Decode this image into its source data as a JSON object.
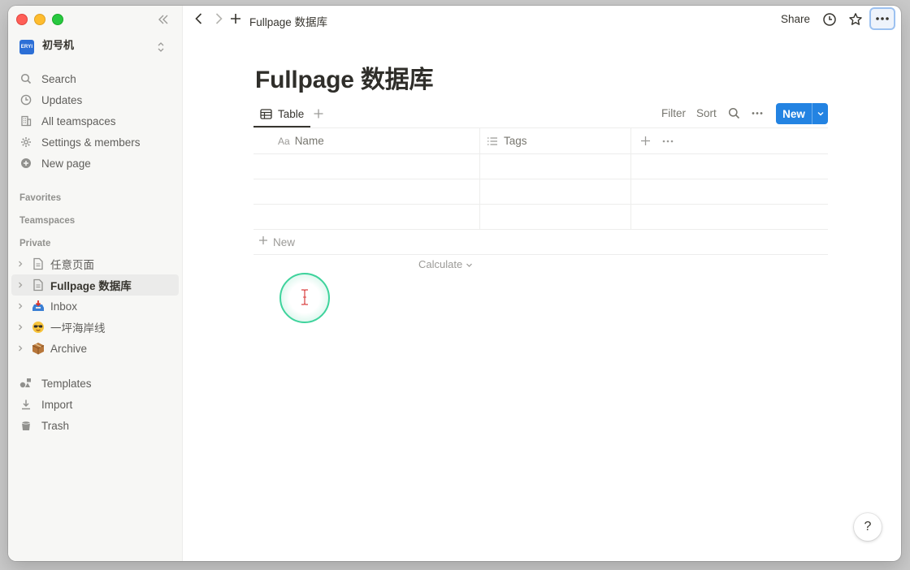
{
  "sidebar": {
    "workspace": {
      "logo_text": "ERYI",
      "name": "初号机"
    },
    "nav": [
      {
        "label": "Search",
        "icon": "search-icon"
      },
      {
        "label": "Updates",
        "icon": "clock-icon"
      },
      {
        "label": "All teamspaces",
        "icon": "building-icon"
      },
      {
        "label": "Settings & members",
        "icon": "gear-icon"
      },
      {
        "label": "New page",
        "icon": "plus-circle-icon"
      }
    ],
    "sections": {
      "favorites": "Favorites",
      "teamspaces": "Teamspaces",
      "private": "Private"
    },
    "pages": [
      {
        "label": "任意页面",
        "icon": "page-icon"
      },
      {
        "label": "Fullpage 数据库",
        "icon": "page-icon",
        "active": true
      },
      {
        "label": "Inbox",
        "icon": "inbox-tray-emoji"
      },
      {
        "label": "一坪海岸线",
        "icon": "sunglasses-face-emoji"
      },
      {
        "label": "Archive",
        "icon": "package-emoji"
      }
    ],
    "bottom": [
      {
        "label": "Templates",
        "icon": "templates-icon"
      },
      {
        "label": "Import",
        "icon": "download-icon"
      },
      {
        "label": "Trash",
        "icon": "trash-icon"
      }
    ]
  },
  "topbar": {
    "breadcrumb": "Fullpage 数据库",
    "share_label": "Share"
  },
  "main": {
    "title": "Fullpage 数据库",
    "view_tab": "Table",
    "filter_label": "Filter",
    "sort_label": "Sort",
    "new_button": "New",
    "columns": [
      {
        "label": "Name",
        "icon_text": "Aa"
      },
      {
        "label": "Tags",
        "icon": "list-icon"
      }
    ],
    "row_count": 3,
    "new_row_label": "New",
    "calculate_label": "Calculate"
  },
  "help_label": "?",
  "colors": {
    "accent": "#2383e2",
    "cursor_ring": "#3ed39c"
  }
}
